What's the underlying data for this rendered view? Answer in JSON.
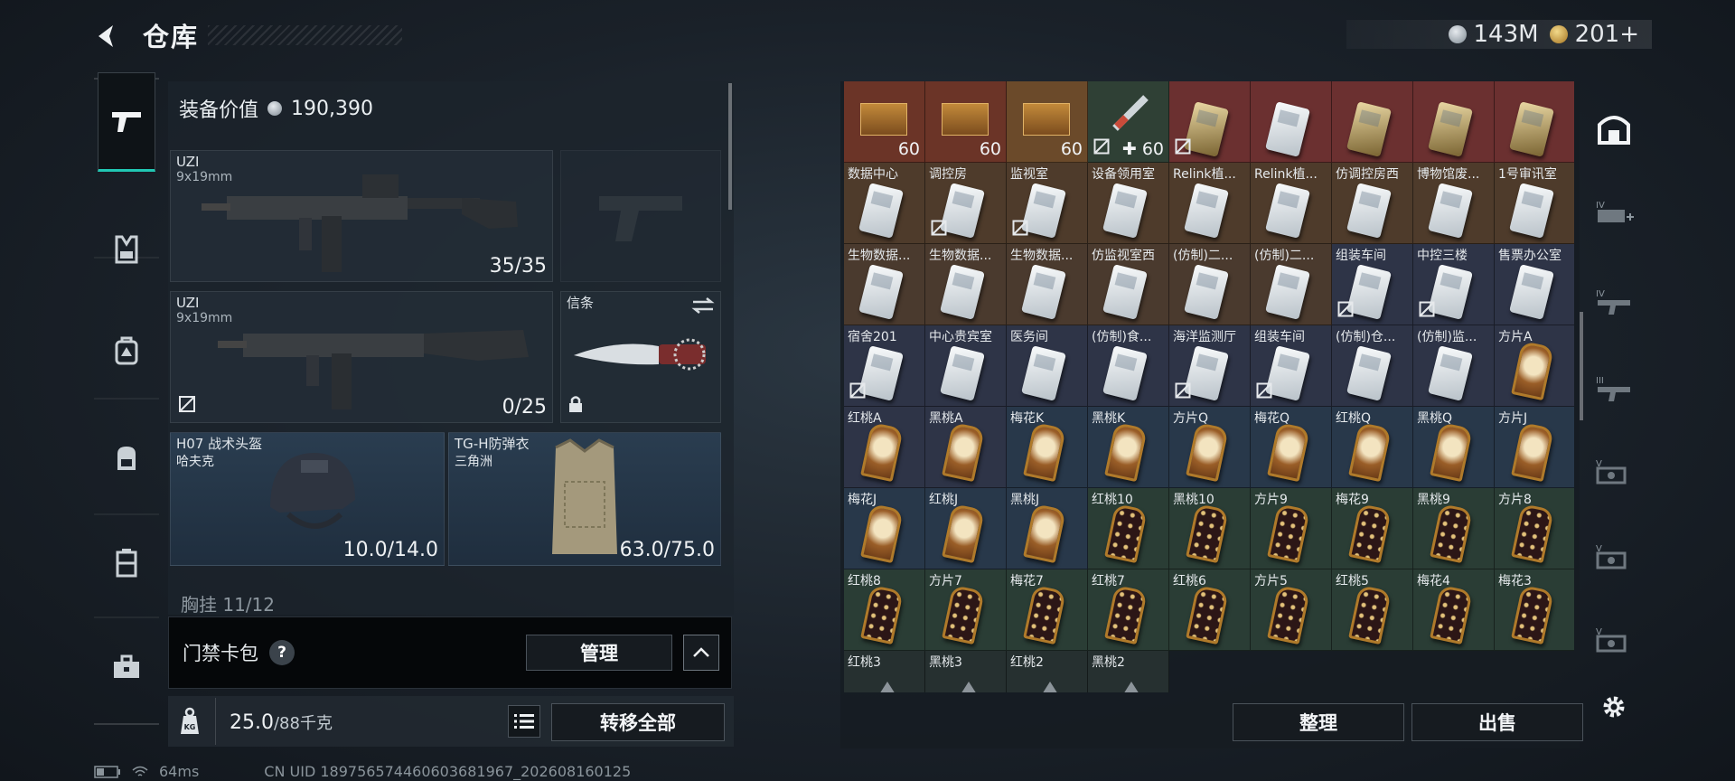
{
  "header": {
    "title": "仓库",
    "back_icon": "back-arrow-icon"
  },
  "currency": {
    "silver": "143M",
    "gold": "201+"
  },
  "rail": [
    "pistol-icon",
    "vest-icon",
    "backpack-icon",
    "bag-icon",
    "case-icon",
    "toolbox-icon"
  ],
  "equipment": {
    "value_label": "装备价值",
    "value": "190,390",
    "primary_weapon": {
      "name": "UZI",
      "caliber": "9x19mm",
      "ammo": "35/35"
    },
    "secondary_weapon": {
      "name": "UZI",
      "caliber": "9x19mm",
      "ammo": "0/25"
    },
    "melee": {
      "name": "信条"
    },
    "helmet": {
      "name": "H07 战术头盔",
      "faction": "哈夫克",
      "durability": "10.0/14.0"
    },
    "armor": {
      "name": "TG-H防弹衣",
      "faction": "三角洲",
      "durability": "63.0/75.0"
    },
    "chest_rig": "胸挂 11/12"
  },
  "keybag": {
    "label": "门禁卡包",
    "help": "?",
    "manage": "管理"
  },
  "weight": {
    "current": "25.0",
    "max": "/88千克",
    "kg_icon": "KG",
    "transfer_all": "转移全部"
  },
  "status": {
    "ping": "64ms",
    "uid": "CN UID 189756574460603681967_202608160125"
  },
  "storage": {
    "items": [
      {
        "name": "",
        "qty": "60",
        "kind": "ammo",
        "bg": "#6b3427"
      },
      {
        "name": "",
        "qty": "60",
        "kind": "ammo",
        "bg": "#6b3427"
      },
      {
        "name": "",
        "qty": "60",
        "kind": "ammo",
        "bg": "#6b4a2a"
      },
      {
        "name": "",
        "qty": "✚ 60",
        "kind": "syringe",
        "bg": "#2f4035",
        "lock": true
      },
      {
        "name": "",
        "qty": "",
        "kind": "gold",
        "bg": "#6b3030",
        "lock": true
      },
      {
        "name": "",
        "qty": "",
        "kind": "card",
        "bg": "#6b3030"
      },
      {
        "name": "",
        "qty": "",
        "kind": "gold",
        "bg": "#6b3030"
      },
      {
        "name": "",
        "qty": "",
        "kind": "gold",
        "bg": "#6b3030"
      },
      {
        "name": "",
        "qty": "",
        "kind": "gold",
        "bg": "#6b3030"
      },
      {
        "name": "数据中心",
        "kind": "card",
        "bg": "#4e3b2b"
      },
      {
        "name": "调控房",
        "kind": "card",
        "bg": "#4e3b2b",
        "lock": true
      },
      {
        "name": "监视室",
        "kind": "card",
        "bg": "#4e3b2b",
        "lock": true
      },
      {
        "name": "设备领用室",
        "kind": "card",
        "bg": "#4e3b2b"
      },
      {
        "name": "Relink植...",
        "kind": "card",
        "bg": "#4e3b2b"
      },
      {
        "name": "Relink植...",
        "kind": "card",
        "bg": "#4e3b2b"
      },
      {
        "name": "仿调控房西",
        "kind": "card",
        "bg": "#4e3b2b"
      },
      {
        "name": "博物馆废...",
        "kind": "card",
        "bg": "#4e3b2b"
      },
      {
        "name": "1号审讯室",
        "kind": "card",
        "bg": "#4e3b2b"
      },
      {
        "name": "生物数据...",
        "kind": "card",
        "bg": "#4a3a2e"
      },
      {
        "name": "生物数据...",
        "kind": "card",
        "bg": "#4a3a2e"
      },
      {
        "name": "生物数据...",
        "kind": "card",
        "bg": "#4a3a2e"
      },
      {
        "name": "仿监视室西",
        "kind": "card",
        "bg": "#4a3a2e"
      },
      {
        "name": "(仿制)二...",
        "kind": "card",
        "bg": "#4a3a2e"
      },
      {
        "name": "(仿制)二...",
        "kind": "card",
        "bg": "#4a3a2e"
      },
      {
        "name": "组装车间",
        "kind": "card",
        "bg": "#2e3447",
        "lock": true
      },
      {
        "name": "中控三楼",
        "kind": "card",
        "bg": "#2e3447",
        "lock": true
      },
      {
        "name": "售票办公室",
        "kind": "card",
        "bg": "#2e3447"
      },
      {
        "name": "宿舍201",
        "kind": "card",
        "bg": "#2e3447",
        "lock": true
      },
      {
        "name": "中心贵宾室",
        "kind": "card",
        "bg": "#2e3447"
      },
      {
        "name": "医务间",
        "kind": "card",
        "bg": "#2e3447"
      },
      {
        "name": "(仿制)食...",
        "kind": "card",
        "bg": "#2e3447"
      },
      {
        "name": "海洋监测厅",
        "kind": "card",
        "bg": "#2e3447",
        "lock": true
      },
      {
        "name": "组装车间",
        "kind": "card",
        "bg": "#2e3447",
        "lock": true
      },
      {
        "name": "(仿制)仓...",
        "kind": "card",
        "bg": "#2e3447"
      },
      {
        "name": "(仿制)监...",
        "kind": "card",
        "bg": "#2e3447"
      },
      {
        "name": "方片A",
        "kind": "face",
        "bg": "#2e3447"
      },
      {
        "name": "红桃A",
        "kind": "face",
        "bg": "#2e3447"
      },
      {
        "name": "黑桃A",
        "kind": "face",
        "bg": "#2e3447"
      },
      {
        "name": "梅花K",
        "kind": "face",
        "bg": "#28384a"
      },
      {
        "name": "黑桃K",
        "kind": "face",
        "bg": "#28384a"
      },
      {
        "name": "方片Q",
        "kind": "face",
        "bg": "#28384a"
      },
      {
        "name": "梅花Q",
        "kind": "face",
        "bg": "#28384a"
      },
      {
        "name": "红桃Q",
        "kind": "face",
        "bg": "#28384a"
      },
      {
        "name": "黑桃Q",
        "kind": "face",
        "bg": "#28384a"
      },
      {
        "name": "方片J",
        "kind": "face",
        "bg": "#28384a"
      },
      {
        "name": "梅花J",
        "kind": "face",
        "bg": "#28384a"
      },
      {
        "name": "红桃J",
        "kind": "face",
        "bg": "#28384a"
      },
      {
        "name": "黑桃J",
        "kind": "face",
        "bg": "#28384a"
      },
      {
        "name": "红桃10",
        "kind": "pip",
        "bg": "#2a3d35"
      },
      {
        "name": "黑桃10",
        "kind": "pip",
        "bg": "#2a3d35"
      },
      {
        "name": "方片9",
        "kind": "pip",
        "bg": "#2a3d35"
      },
      {
        "name": "梅花9",
        "kind": "pip",
        "bg": "#2a3d35"
      },
      {
        "name": "黑桃9",
        "kind": "pip",
        "bg": "#2a3d35"
      },
      {
        "name": "方片8",
        "kind": "pip",
        "bg": "#2a3d35"
      },
      {
        "name": "红桃8",
        "kind": "pip",
        "bg": "#2a3d35"
      },
      {
        "name": "方片7",
        "kind": "pip",
        "bg": "#2a3d35"
      },
      {
        "name": "梅花7",
        "kind": "pip",
        "bg": "#2a3d35"
      },
      {
        "name": "红桃7",
        "kind": "pip",
        "bg": "#2a3d35"
      },
      {
        "name": "红桃6",
        "kind": "pip",
        "bg": "#2a3d35"
      },
      {
        "name": "方片5",
        "kind": "pip",
        "bg": "#2a3d35"
      },
      {
        "name": "红桃5",
        "kind": "pip",
        "bg": "#2a3d35"
      },
      {
        "name": "梅花4",
        "kind": "pip",
        "bg": "#2a3d35"
      },
      {
        "name": "梅花3",
        "kind": "pip",
        "bg": "#2a3d35"
      },
      {
        "name": "红桃3",
        "kind": "tri",
        "bg": "#263030"
      },
      {
        "name": "黑桃3",
        "kind": "tri",
        "bg": "#263030"
      },
      {
        "name": "红桃2",
        "kind": "tri",
        "bg": "#263030"
      },
      {
        "name": "黑桃2",
        "kind": "tri",
        "bg": "#263030"
      }
    ],
    "sort": "整理",
    "sell": "出售"
  },
  "tools": [
    "building-icon",
    "gun-add-icon-iv",
    "gun-filter-icon-iv",
    "gun-filter-icon-iii",
    "gun-filter-icon-v",
    "gun-filter-icon-v",
    "gun-filter-icon-v",
    "settings-gear-icon"
  ]
}
